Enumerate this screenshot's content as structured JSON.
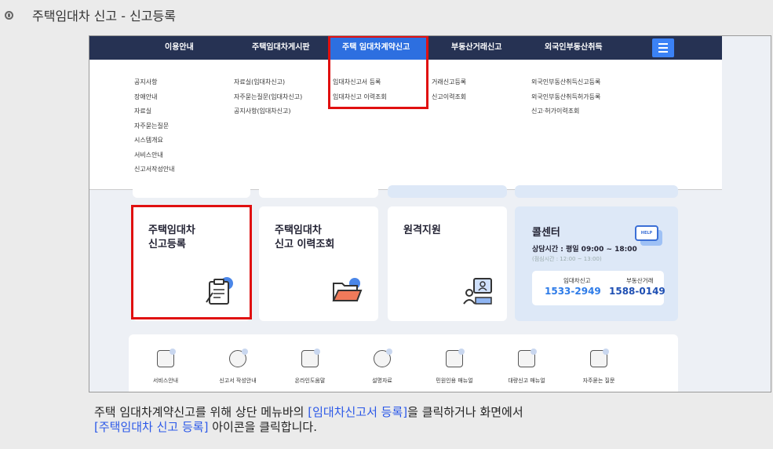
{
  "doc_title": "주택임대차 신고 - 신고등록",
  "nav": {
    "items": [
      "이용안내",
      "주택임대차게시판",
      "주택 임대차계약신고",
      "부동산거래신고",
      "외국인부동산취득"
    ],
    "active_index": 2
  },
  "dropdown": {
    "col1": [
      "공지사항",
      "장애안내",
      "자료실",
      "자주묻는질문",
      "시스템개요",
      "서비스안내",
      "신고서작성안내"
    ],
    "col2": [
      "자료실(임대차신고)",
      "자주묻는질문(임대차신고)",
      "공지사항(임대차신고)"
    ],
    "col3": [
      "임대차신고서 등록",
      "임대차신고 이력조회"
    ],
    "col4": [
      "거래신고등록",
      "신고이력조회"
    ],
    "col5": [
      "외국인부동산취득신고등록",
      "외국인부동산취득허가등록",
      "신고·허가이력조회"
    ]
  },
  "cards": {
    "register": {
      "line1": "주택임대차",
      "line2": "신고등록"
    },
    "history": {
      "line1": "주택임대차",
      "line2": "신고 이력조회"
    },
    "remote": {
      "title": "원격지원"
    }
  },
  "call_center": {
    "title": "콜센터",
    "help_badge": "HELP",
    "hours": "상담시간 : 평일 09:00 ~ 18:00",
    "lunch": "(점심시간 : 12:00 ~ 13:00)",
    "lease_label": "임대차신고",
    "lease_number": "1533-2949",
    "trade_label": "부동산거래",
    "trade_number": "1588-0149"
  },
  "bottom_items": [
    "서비스안내",
    "신고서 작성안내",
    "온라인도움말",
    "설명자료",
    "민원인용 매뉴얼",
    "대량신고 매뉴얼",
    "자주묻는 질문"
  ],
  "description": {
    "p1": "주택 임대차계약신고를 위해 상단 메뉴바의 ",
    "hl1": "[임대차신고서 등록]",
    "p2": "을 클릭하거나 화면에서",
    "hl2": "[주택임대차 신고 등록]",
    "p3": " 아이콘을 클릭합니다."
  },
  "colors": {
    "nav_bg": "#263253",
    "nav_active": "#2d6fe0",
    "highlight_box": "#e01010",
    "link_text": "#2b58e8",
    "phone_lease": "#2d7be8",
    "phone_trade": "#1e4fb3"
  }
}
